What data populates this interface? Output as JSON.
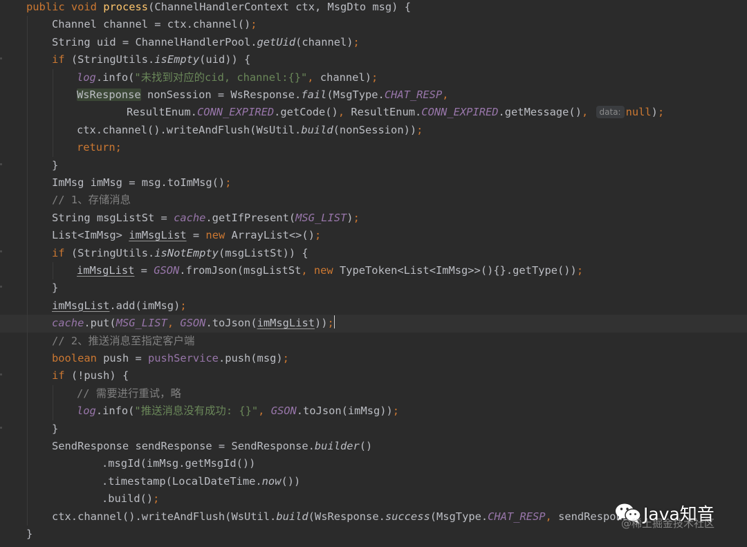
{
  "colors": {
    "background": "#2b2b2b",
    "current_line": "#323232",
    "default_text": "#bcbec4",
    "keyword": "#cc7832",
    "method_declaration": "#ffc66d",
    "string": "#6a8759",
    "comment": "#808080",
    "static_field": "#9876aa",
    "highlight_bg": "#3b4736"
  },
  "editor": {
    "language": "Java",
    "lines": [
      "public void process(ChannelHandlerContext ctx, MsgDto msg) {",
      "    Channel channel = ctx.channel();",
      "    String uid = ChannelHandlerPool.getUid(channel);",
      "    if (StringUtils.isEmpty(uid)) {",
      "        log.info(\"未找到对应的cid, channel:{}\", channel);",
      "        WsResponse nonSession = WsResponse.fail(MsgType.CHAT_RESP,",
      "                ResultEnum.CONN_EXPIRED.getCode(), ResultEnum.CONN_EXPIRED.getMessage(),  data: null);",
      "        ctx.channel().writeAndFlush(WsUtil.build(nonSession));",
      "        return;",
      "    }",
      "    ImMsg imMsg = msg.toImMsg();",
      "    // 1、存储消息",
      "    String msgListSt = cache.getIfPresent(MSG_LIST);",
      "    List<ImMsg> imMsgList = new ArrayList<>();",
      "    if (StringUtils.isNotEmpty(msgListSt)) {",
      "        imMsgList = GSON.fromJson(msgListSt, new TypeToken<List<ImMsg>>(){}.getType());",
      "    }",
      "    imMsgList.add(imMsg);",
      "    cache.put(MSG_LIST, GSON.toJson(imMsgList));",
      "    // 2、推送消息至指定客户端",
      "    boolean push = pushService.push(msg);",
      "    if (!push) {",
      "        // 需要进行重试，略",
      "        log.info(\"推送消息没有成功: {}\", GSON.toJson(imMsg));",
      "    }",
      "    SendResponse sendResponse = SendResponse.builder()",
      "            .msgId(imMsg.getMsgId())",
      "            .timestamp(LocalDateTime.now())",
      "            .build();",
      "    ctx.channel().writeAndFlush(WsUtil.build(WsResponse.success(MsgType.CHAT_RESP, sendResponse",
      "}"
    ],
    "inlay_hint": "data:",
    "current_line_number": 19
  },
  "watermark": {
    "icon": "wechat-icon",
    "title": "Java知音",
    "credit": "@稀土掘金技术社区"
  }
}
